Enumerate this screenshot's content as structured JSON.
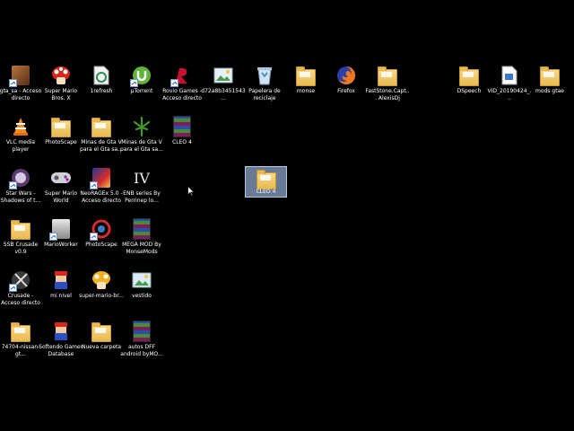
{
  "desktop": {
    "selected_icon_label": "CLEO 4",
    "icons": [
      {
        "label": "gta_sa - Acceso directo",
        "icon": "gta-sa-icon"
      },
      {
        "label": "Super Mario Bros. X",
        "icon": "mushroom-icon"
      },
      {
        "label": "1refresh",
        "icon": "refresh-file-icon"
      },
      {
        "label": "µTorrent",
        "icon": "utorrent-icon"
      },
      {
        "label": "Rovio Games - Acceso directo",
        "icon": "rovio-icon"
      },
      {
        "label": "d72a8b3451543...",
        "icon": "image-file-icon"
      },
      {
        "label": "Papelera de reciclaje",
        "icon": "recycle-bin-icon"
      },
      {
        "label": "monse",
        "icon": "folder-icon"
      },
      {
        "label": "Firefox",
        "icon": "firefox-icon"
      },
      {
        "label": "FastStone.Capt... AlexisDj",
        "icon": "folder-icon"
      },
      {
        "label": "DSpeech",
        "icon": "folder-icon"
      },
      {
        "label": "VID_20190424_...",
        "icon": "video-file-icon"
      },
      {
        "label": "mods gtae",
        "icon": "folder-icon"
      },
      {
        "label": "VLC media player",
        "icon": "vlc-icon"
      },
      {
        "label": "PhotoScape",
        "icon": "folder-icon"
      },
      {
        "label": "Minas de Gta V para el Gta sa...",
        "icon": "folder-icon"
      },
      {
        "label": "Minas de Gta V para el Gta sa...",
        "icon": "leaf-icon"
      },
      {
        "label": "CLEO 4",
        "icon": "winrar-icon"
      },
      {
        "label": "Star Wars - Shadows of t...",
        "icon": "star-wars-icon"
      },
      {
        "label": "Super Mario World",
        "icon": "gamepad-icon"
      },
      {
        "label": "NeoRAGEx 5.0 - Acceso directo",
        "icon": "neoragex-icon"
      },
      {
        "label": "ENB series By Perrinep lo...",
        "icon": "enb-icon"
      },
      {
        "label": "SSB Crusade v0.9",
        "icon": "folder-icon"
      },
      {
        "label": "MarioWorker",
        "icon": "marioworker-icon"
      },
      {
        "label": "PhotoScape",
        "icon": "photoscape-icon"
      },
      {
        "label": "MEGA MOD By MonseMods",
        "icon": "winrar-icon"
      },
      {
        "label": "Crusade - Acceso directo",
        "icon": "crusade-icon"
      },
      {
        "label": "mi nivel",
        "icon": "mario-icon"
      },
      {
        "label": "super-mario-br...",
        "icon": "mushroom-gold-icon"
      },
      {
        "label": "vestido",
        "icon": "image-file-icon"
      },
      {
        "label": "74704-nissan-gt...",
        "icon": "folder-icon"
      },
      {
        "label": "Softendo Games Database",
        "icon": "mario-icon"
      },
      {
        "label": "Nueva carpeta",
        "icon": "folder-icon"
      },
      {
        "label": "autos DFF android byMO...",
        "icon": "winrar-icon"
      }
    ],
    "colors": {
      "background": "#000000",
      "selection": "#8ba3c7",
      "folder": "#e9b94f"
    }
  }
}
